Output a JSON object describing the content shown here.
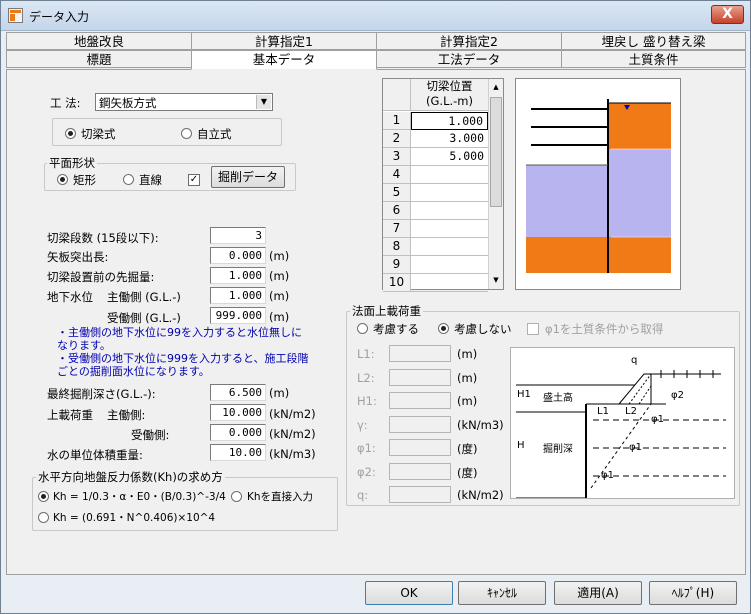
{
  "window": {
    "title": "データ入力",
    "close": "X"
  },
  "tabs": {
    "row1": [
      "地盤改良",
      "計算指定1",
      "計算指定2",
      "埋戻し 盛り替え梁"
    ],
    "row2": [
      "標題",
      "基本データ",
      "工法データ",
      "土質条件"
    ]
  },
  "method": {
    "label": "工 法:",
    "value": "鋼矢板方式",
    "options": [
      "切梁式",
      "自立式"
    ],
    "selected": "切梁式"
  },
  "plan": {
    "title": "平面形状",
    "options": [
      "矩形",
      "直線"
    ],
    "selected": "矩形",
    "checked": true,
    "button": "掘削データ"
  },
  "fields": {
    "strut_count": {
      "label": "切梁段数 (15段以下):",
      "value": "3",
      "unit": ""
    },
    "protrusion": {
      "label": "矢板突出長:",
      "value": "0.000",
      "unit": "(m)"
    },
    "pre_dig": {
      "label": "切梁設置前の先掘量:",
      "value": "1.000",
      "unit": "(m)"
    },
    "gw_label": "地下水位",
    "gw_main": {
      "label": "主働側 (G.L.-)",
      "value": "1.000",
      "unit": "(m)"
    },
    "gw_passive": {
      "label": "受働側 (G.L.-)",
      "value": "999.000",
      "unit": "(m)"
    },
    "note1": "・主働側の地下水位に99を入力すると水位無しに なります。",
    "note2": "・受働側の地下水位に999を入力すると、施工段階 ごとの掘削面水位になります。",
    "final_dig": {
      "label": "最終掘削深さ(G.L.-):",
      "value": "6.500",
      "unit": "(m)"
    },
    "load_label": "上載荷重",
    "load_main": {
      "label": "主働側:",
      "value": "10.000",
      "unit": "(kN/m2)"
    },
    "load_passive": {
      "label": "受働側:",
      "value": "0.000",
      "unit": "(kN/m2)"
    },
    "water_weight": {
      "label": "水の単位体積重量:",
      "value": "10.00",
      "unit": "(kN/m3)"
    }
  },
  "kh": {
    "title": "水平方向地盤反力係数(Kh)の求め方",
    "option1": "Kh = 1/0.3・α・E0・(B/0.3)^-3/4",
    "option2": "Khを直接入力",
    "option3": "Kh = (0.691・N^0.406)×10^4",
    "selected": "option1"
  },
  "grid": {
    "header1": "切梁位置",
    "header2": "(G.L.-m)",
    "rows": [
      {
        "n": "1",
        "v": "1.000"
      },
      {
        "n": "2",
        "v": "3.000"
      },
      {
        "n": "3",
        "v": "5.000"
      },
      {
        "n": "4",
        "v": ""
      },
      {
        "n": "5",
        "v": ""
      },
      {
        "n": "6",
        "v": ""
      },
      {
        "n": "7",
        "v": ""
      },
      {
        "n": "8",
        "v": ""
      },
      {
        "n": "9",
        "v": ""
      },
      {
        "n": "10",
        "v": ""
      }
    ]
  },
  "slope": {
    "title": "法面上載荷重",
    "options": [
      "考慮する",
      "考慮しない"
    ],
    "selected": "考慮しない",
    "checkbox": "φ1を土質条件から取得",
    "params": [
      {
        "label": "L1:",
        "unit": "(m)"
      },
      {
        "label": "L2:",
        "unit": "(m)"
      },
      {
        "label": "H1:",
        "unit": "(m)"
      },
      {
        "label": "γ:",
        "unit": "(kN/m3)"
      },
      {
        "label": "φ1:",
        "unit": "(度)"
      },
      {
        "label": "φ2:",
        "unit": "(度)"
      },
      {
        "label": "q:",
        "unit": "(kN/m2)"
      }
    ],
    "diagram": {
      "q": "q",
      "h1": "H1",
      "fill": "盛土高",
      "l1": "L1",
      "l2": "L2",
      "h": "H",
      "dig": "掘削深",
      "phi2": "φ2",
      "phi1": "φ1"
    }
  },
  "buttons": {
    "ok": "OK",
    "cancel": "ｷｬﾝｾﾙ",
    "apply": "適用(A)",
    "help": "ﾍﾙﾌﾟ(H)"
  },
  "colors": {
    "orange": "#f07a15",
    "purple": "#b8b4f0",
    "red_ok": "#a00000"
  }
}
